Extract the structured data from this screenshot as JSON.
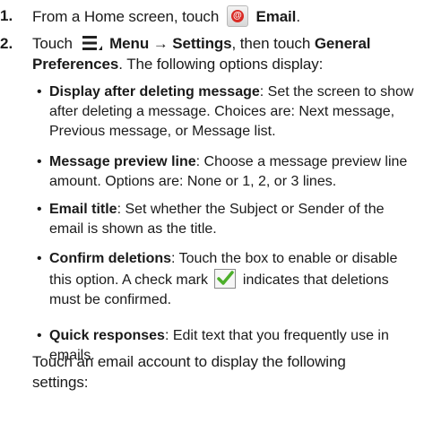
{
  "steps": [
    {
      "number": "1.",
      "pre": "From a Home screen, touch",
      "icon": "email-app-icon",
      "bold": "Email",
      "post": "."
    },
    {
      "number": "2.",
      "touch": "Touch",
      "menu_icon": "menu-icon",
      "menu_label": "Menu",
      "arrow": "→",
      "settings": "Settings",
      "then": ", then touch",
      "general": "General Preferences",
      "after": ". The following options display:"
    }
  ],
  "bullets": [
    {
      "bold": "Display after deleting message",
      "text": ": Set the screen to show after deleting a message. Choices are: Next message, Previous message, or Message list."
    },
    {
      "bold": "Message preview line",
      "text": ": Choose a message preview line amount. Options are: None or 1, 2, or 3 lines."
    },
    {
      "bold": "Email title",
      "text": ": Set whether the Subject or Sender of the email is shown as the title."
    },
    {
      "bold": "Confirm deletions",
      "text_before": ": Touch the box to enable or disable this option. A check mark",
      "icon": "check-mark-icon",
      "text_after": "indicates that deletions must be confirmed."
    },
    {
      "bold": "Quick responses",
      "text": ": Edit text that you frequently use in emails."
    }
  ],
  "footer": "Touch an email account to display the following settings:",
  "colors": {
    "text": "#1a1a1a",
    "email_icon": "#d92b25",
    "check_green": "#4caf2a"
  }
}
